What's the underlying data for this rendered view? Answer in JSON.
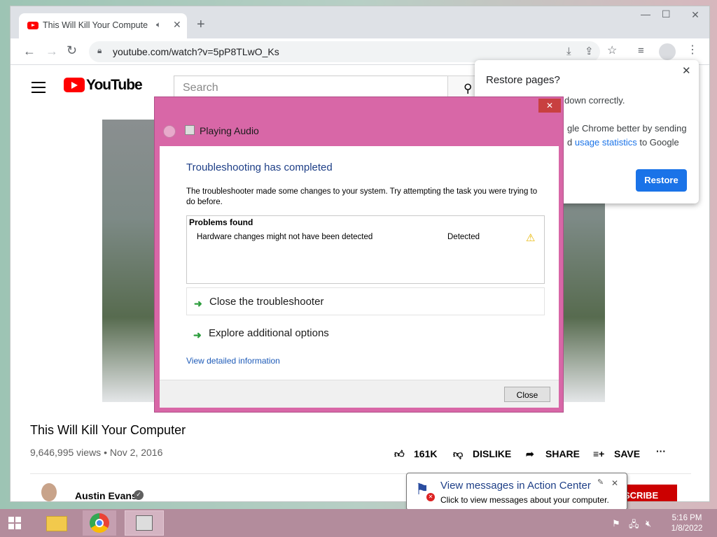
{
  "browser": {
    "tab_title": "This Will Kill Your Computer",
    "new_tab": "+",
    "url": "youtube.com/watch?v=5pP8TLwO_Ks",
    "window_controls": [
      "–",
      "▢",
      "✕"
    ]
  },
  "youtube": {
    "logo_text": "YouTube",
    "search_placeholder": "Search",
    "video_title": "This Will Kill Your Computer",
    "video_meta": "9,646,995 views • Nov 2, 2016",
    "actions": {
      "like": "161K",
      "dislike": "DISLIKE",
      "share": "SHARE",
      "save": "SAVE"
    },
    "channel": "Austin Evans",
    "subscribe": "SCRIBE"
  },
  "restore_popup": {
    "title": "Restore pages?",
    "body_line1": "down correctly.",
    "body_line2": "gle Chrome better by sending",
    "body_line3_prefix": "d ",
    "body_link": "usage statistics",
    "body_line3_suffix": " to Google",
    "button": "Restore"
  },
  "troubleshooter": {
    "window_title": "Playing Audio",
    "heading": "Troubleshooting has completed",
    "description": "The troubleshooter made some changes to your system. Try attempting the task you were trying to do before.",
    "problems_header": "Problems found",
    "problems": [
      {
        "name": "Hardware changes might not have been detected",
        "status": "Detected"
      }
    ],
    "option_close": "Close the troubleshooter",
    "option_explore": "Explore additional options",
    "detail_link": "View detailed information",
    "close_button": "Close",
    "title_close": "✕"
  },
  "action_center": {
    "title": "View messages in Action Center",
    "subtitle": "Click to view messages about your computer."
  },
  "clock": {
    "time": "5:16 PM",
    "date": "1/8/2022"
  },
  "colors": {
    "dialog_frame": "#d867a7",
    "taskbar": "#b38c9c",
    "youtube_red": "#ff0000",
    "chrome_blue": "#1a73e8"
  }
}
